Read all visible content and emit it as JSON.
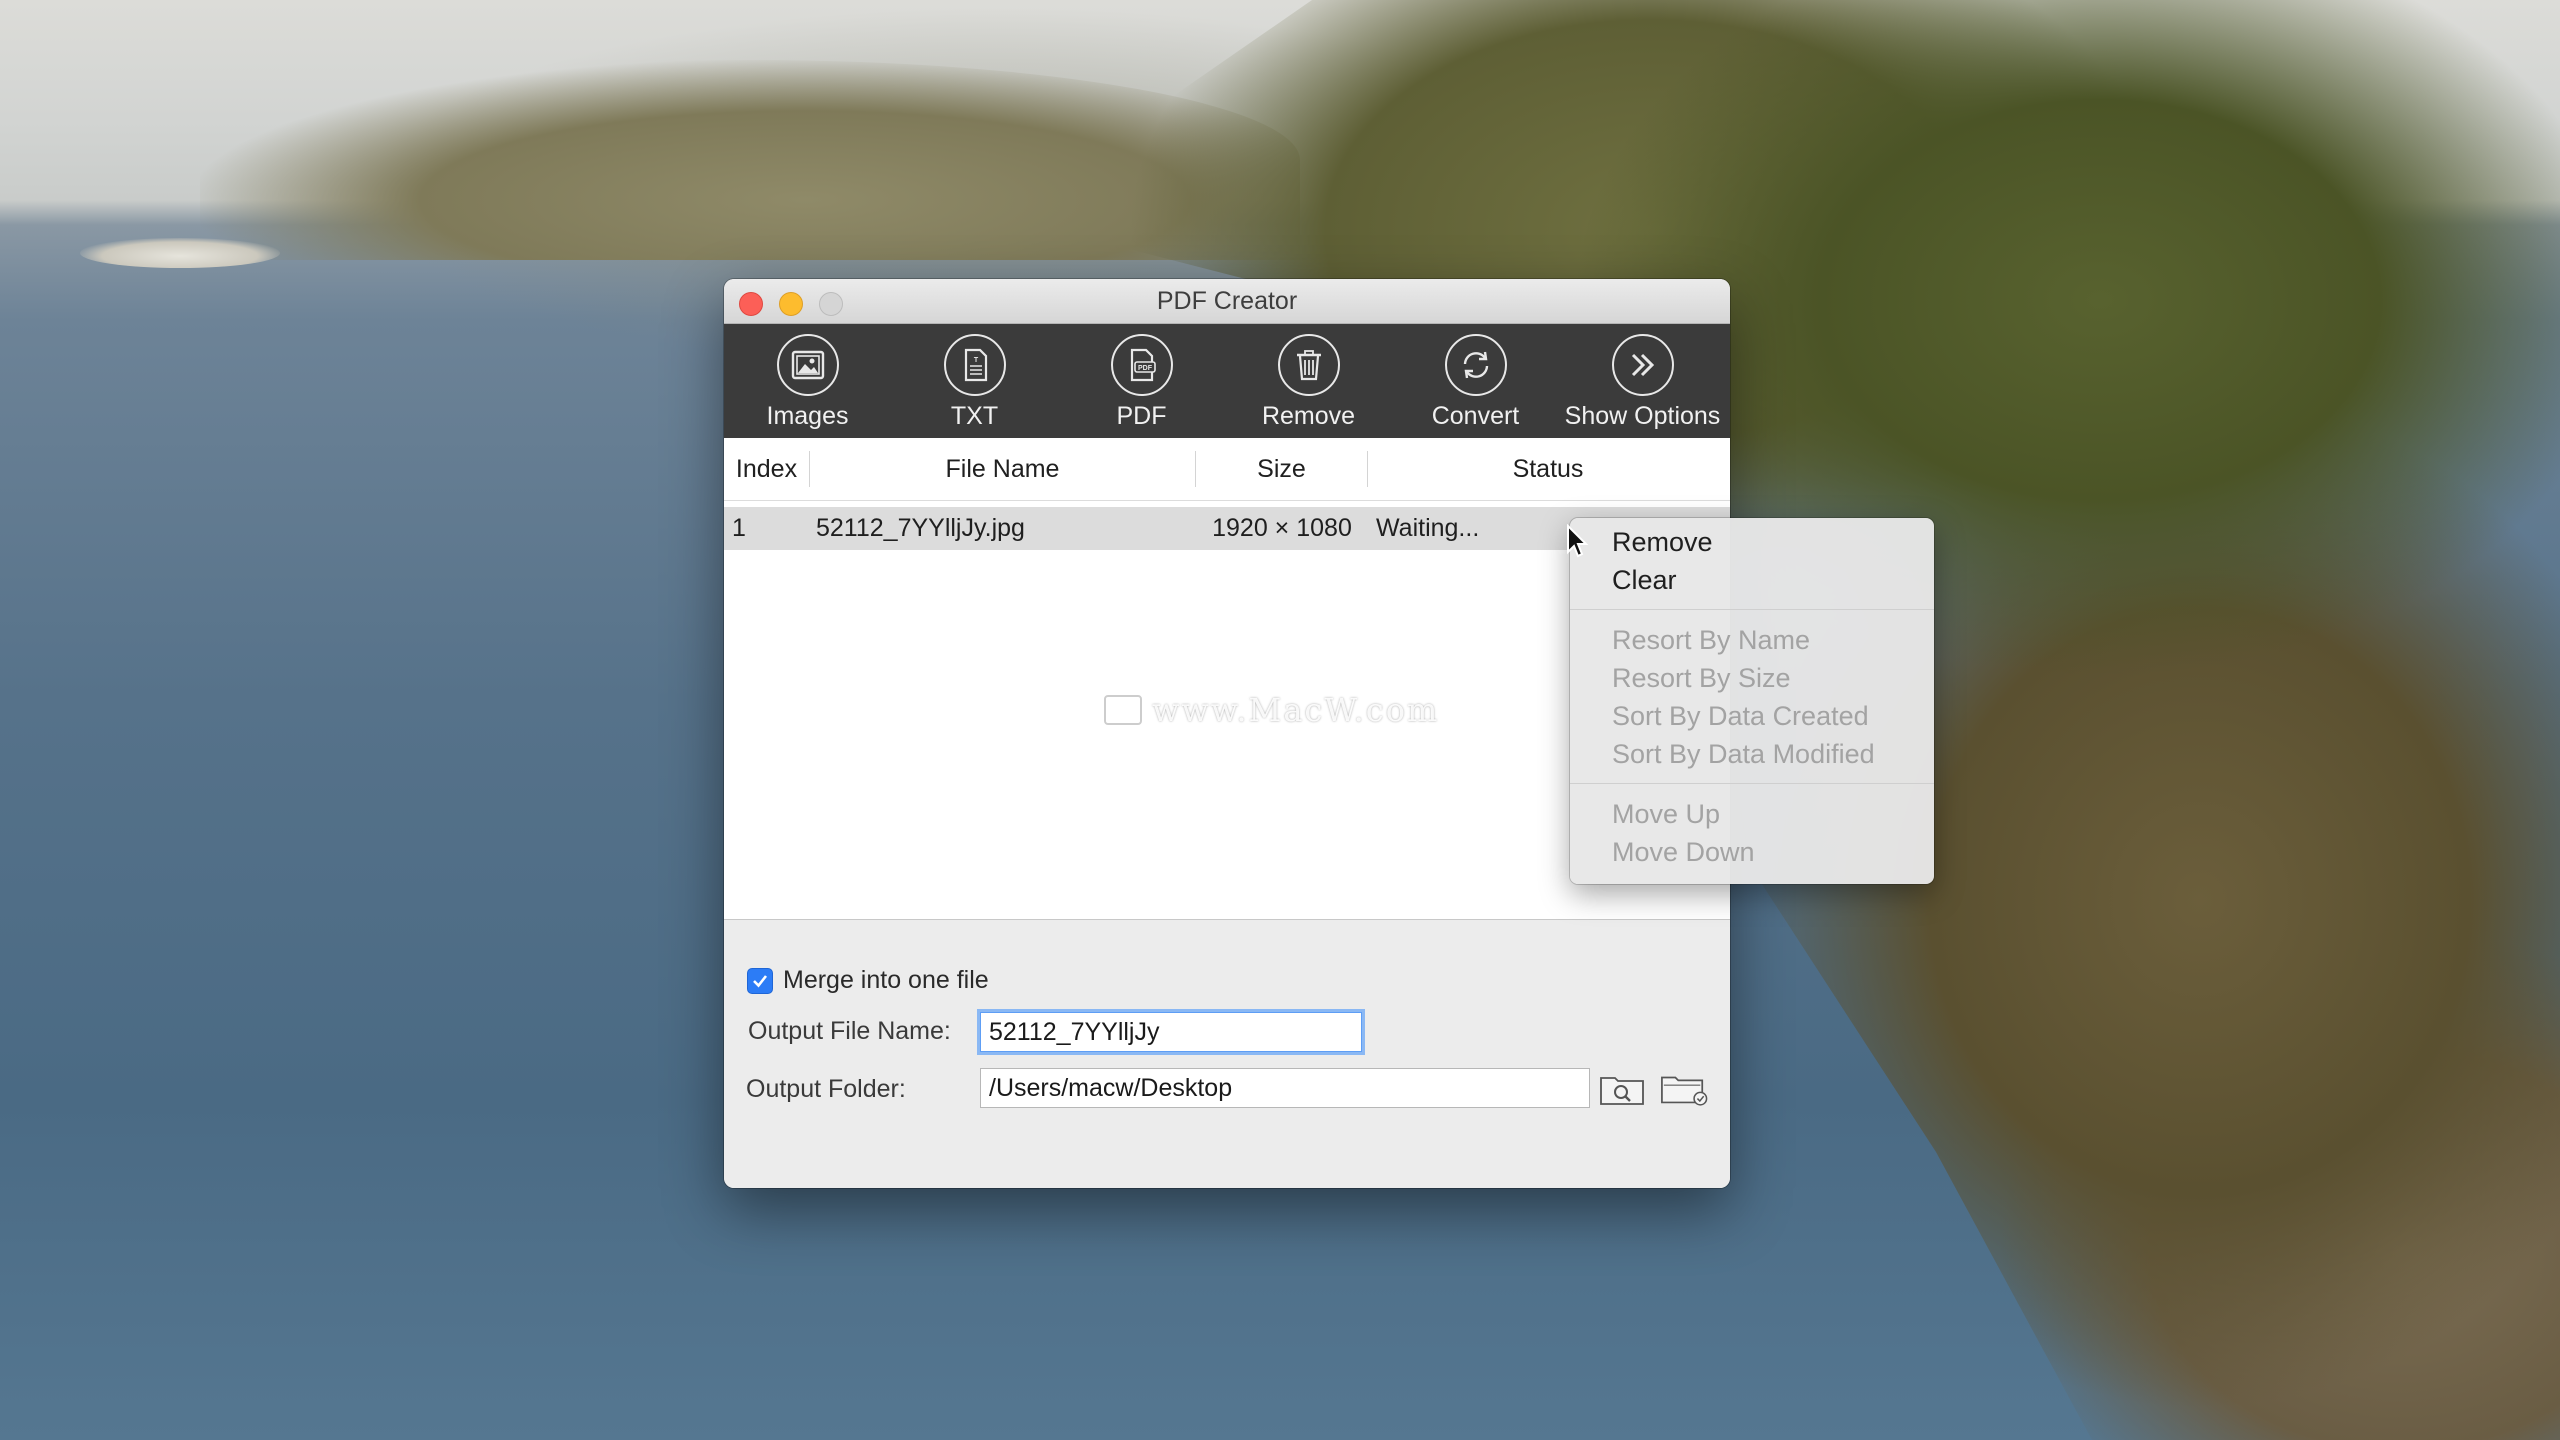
{
  "window": {
    "title": "PDF Creator"
  },
  "toolbar": {
    "items": [
      {
        "label": "Images",
        "icon": "image-icon"
      },
      {
        "label": "TXT",
        "icon": "text-document-icon"
      },
      {
        "label": "PDF",
        "icon": "pdf-document-icon"
      },
      {
        "label": "Remove",
        "icon": "trash-icon"
      },
      {
        "label": "Convert",
        "icon": "convert-icon"
      },
      {
        "label": "Show Options",
        "icon": "double-chevron-right-icon"
      }
    ]
  },
  "table": {
    "columns": [
      "Index",
      "File Name",
      "Size",
      "Status"
    ],
    "rows": [
      {
        "index": "1",
        "name": "52112_7YYlljJy.jpg",
        "size": "1920 × 1080",
        "status": "Waiting..."
      }
    ]
  },
  "watermark": {
    "text": "www.MacW.com"
  },
  "options": {
    "merge_label": "Merge into one file",
    "merge_checked": true,
    "output_file_label": "Output File Name:",
    "output_file_value": "52112_7YYlljJy",
    "output_folder_label": "Output Folder:",
    "output_folder_value": "/Users/macw/Desktop"
  },
  "context_menu": {
    "group1": [
      "Remove",
      "Clear"
    ],
    "group2": [
      "Resort By Name",
      "Resort By Size",
      "Sort By Data Created",
      "Sort By Data Modified"
    ],
    "group3": [
      "Move Up",
      "Move Down"
    ]
  },
  "colors": {
    "toolbar_bg": "#3b3b3b",
    "accent": "#2c7cf6",
    "close": "#fc5f57",
    "minimize": "#fdbc2e"
  }
}
